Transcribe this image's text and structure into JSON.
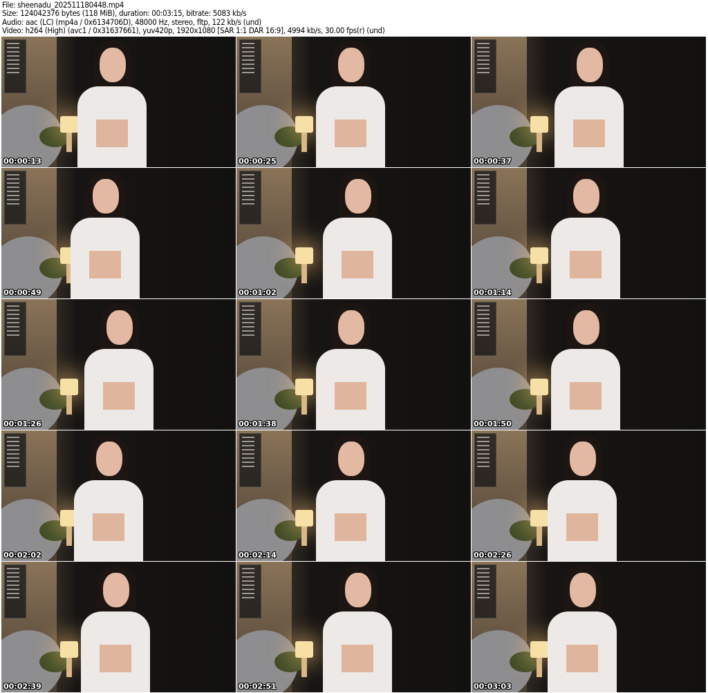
{
  "header": {
    "file": "File: sheenadu_202511180448.mp4",
    "size": "Size: 124042376 bytes (118 MiB), duration: 00:03:15, bitrate: 5083 kb/s",
    "audio": "Audio: aac (LC) (mp4a / 0x6134706D), 48000 Hz, stereo, fltp, 122 kb/s (und)",
    "video": "Video: h264 (High) (avc1 / 0x31637661), yuv420p, 1920x1080 [SAR 1:1 DAR 16:9], 4994 kb/s, 30.00 fps(r) (und)"
  },
  "thumbnails": [
    {
      "time": "00:00:13"
    },
    {
      "time": "00:00:25"
    },
    {
      "time": "00:00:37"
    },
    {
      "time": "00:00:49"
    },
    {
      "time": "00:01:02"
    },
    {
      "time": "00:01:14"
    },
    {
      "time": "00:01:26"
    },
    {
      "time": "00:01:38"
    },
    {
      "time": "00:01:50"
    },
    {
      "time": "00:02:02"
    },
    {
      "time": "00:02:14"
    },
    {
      "time": "00:02:26"
    },
    {
      "time": "00:02:39"
    },
    {
      "time": "00:02:51"
    },
    {
      "time": "00:03:03"
    }
  ]
}
